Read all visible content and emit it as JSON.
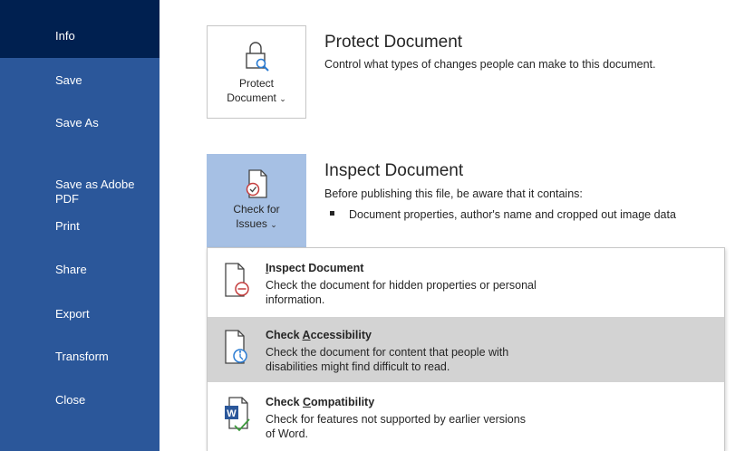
{
  "sidebar": {
    "items": [
      {
        "label": "Info",
        "selected": true
      },
      {
        "label": "Save"
      },
      {
        "label": "Save As"
      },
      {
        "label": "Save as Adobe\nPDF"
      },
      {
        "label": "Print"
      },
      {
        "label": "Share"
      },
      {
        "label": "Export"
      },
      {
        "label": "Transform"
      },
      {
        "label": "Close"
      }
    ]
  },
  "protect": {
    "button_line1": "Protect",
    "button_line2": "Document",
    "chevron": "⌄",
    "title": "Protect Document",
    "desc": "Control what types of changes people can make to this document."
  },
  "inspect": {
    "button_line1": "Check for",
    "button_line2": "Issues",
    "chevron": "⌄",
    "title": "Inspect Document",
    "desc": "Before publishing this file, be aware that it contains:",
    "bullet": "Document properties, author's name and cropped out image data"
  },
  "menu": {
    "items": [
      {
        "title_pre": "",
        "title_ul": "I",
        "title_post": "nspect Document",
        "desc": "Check the document for hidden properties or personal information.",
        "icon": "inspect-document-icon"
      },
      {
        "title_pre": "Check ",
        "title_ul": "A",
        "title_post": "ccessibility",
        "desc": "Check the document for content that people with disabilities might find difficult to read.",
        "icon": "accessibility-icon"
      },
      {
        "title_pre": "Check ",
        "title_ul": "C",
        "title_post": "ompatibility",
        "desc": "Check for features not supported by earlier versions of Word.",
        "icon": "compatibility-icon"
      }
    ]
  },
  "colors": {
    "sidebar": "#2b579a",
    "sidebar_selected": "#002050",
    "tile_active": "#a6c0e4",
    "menu_hover": "#d3d3d3"
  }
}
